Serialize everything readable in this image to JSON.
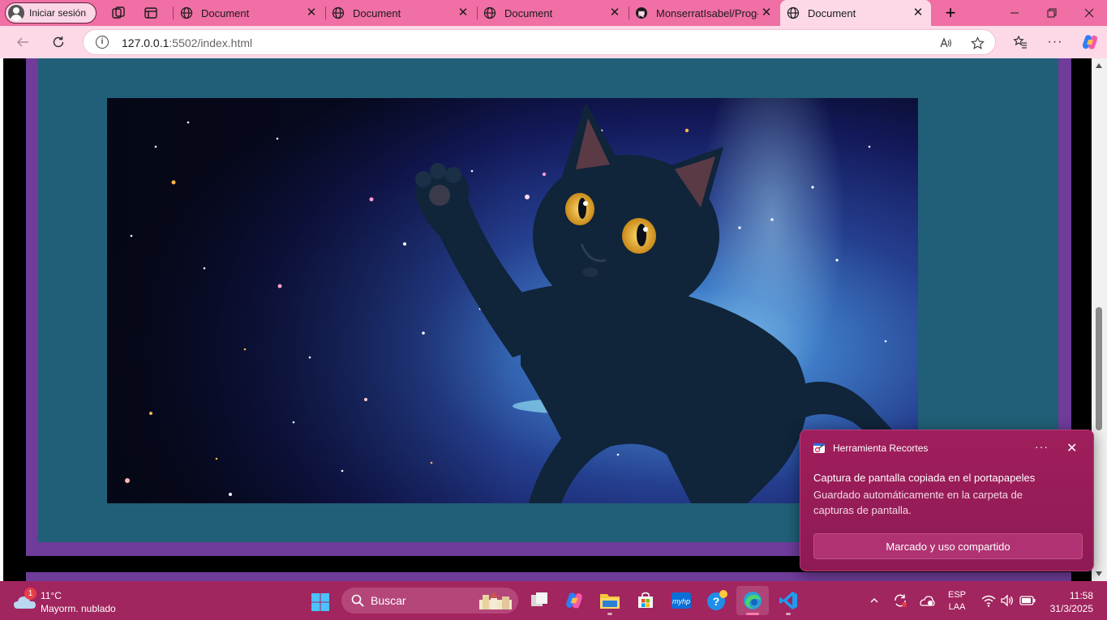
{
  "browser": {
    "profile_label": "Iniciar sesión",
    "tabs": [
      {
        "title": "Document",
        "icon": "globe-icon",
        "active": false
      },
      {
        "title": "Document",
        "icon": "globe-icon",
        "active": false
      },
      {
        "title": "Document",
        "icon": "globe-icon",
        "active": false
      },
      {
        "title": "MonserratIsabel/Prog-w",
        "icon": "github-icon",
        "active": false
      },
      {
        "title": "Document",
        "icon": "globe-icon",
        "active": true
      }
    ],
    "new_tab_symbol": "+",
    "address": {
      "host": "127.0.0.1",
      "path": ":5502/index.html"
    }
  },
  "page": {
    "hero_image": "black-cat-floating-in-space",
    "colors": {
      "frame": "#000000",
      "purple": "#6f3c9a",
      "teal": "#215f78"
    }
  },
  "toast": {
    "app_name": "Herramienta Recortes",
    "title": "Captura de pantalla copiada en el portapapeles",
    "body": "Guardado automáticamente en la carpeta de capturas de pantalla.",
    "action_label": "Marcado y uso compartido",
    "more_symbol": "···",
    "close_symbol": "✕"
  },
  "taskbar": {
    "weather": {
      "badge": "1",
      "temp": "11°C",
      "condition": "Mayorm. nublado"
    },
    "search_placeholder": "Buscar",
    "language": {
      "top": "ESP",
      "bottom": "LAA"
    },
    "clock": {
      "time": "11:58",
      "date": "31/3/2025"
    },
    "accent": "#a1255e"
  }
}
